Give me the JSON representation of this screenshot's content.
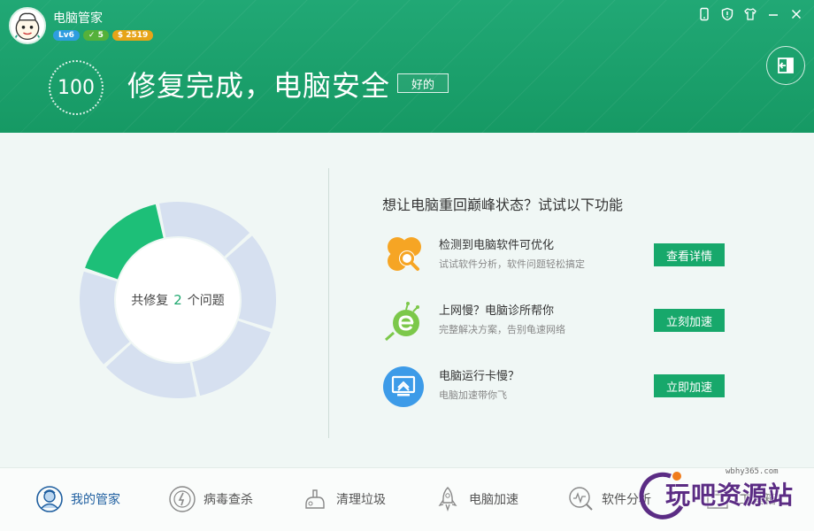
{
  "app": {
    "title": "电脑管家"
  },
  "badges": {
    "level": "Lv6",
    "ok": "5",
    "coins": "2519"
  },
  "window_controls": [
    "phone-icon",
    "shield-icon",
    "shirt-icon",
    "minimize-icon",
    "close-icon"
  ],
  "status": {
    "score": "100",
    "headline": "修复完成，电脑安全",
    "ok_label": "好的"
  },
  "summary": {
    "prefix": "共修复",
    "count": "2",
    "suffix": "个问题",
    "fixed_fraction": 0.167
  },
  "promo": {
    "title": "想让电脑重回巅峰状态？试试以下功能",
    "items": [
      {
        "title": "检测到电脑软件可优化",
        "desc": "试试软件分析，软件问题轻松搞定",
        "button": "查看详情",
        "icon": "clover-search-icon"
      },
      {
        "title": "上网慢？电脑诊所帮你",
        "desc": "完整解决方案，告别龟速网络",
        "button": "立刻加速",
        "icon": "browser-bug-icon"
      },
      {
        "title": "电脑运行卡慢？",
        "desc": "电脑加速带你飞",
        "button": "立即加速",
        "icon": "monitor-boost-icon"
      }
    ]
  },
  "nav": [
    {
      "label": "我的管家",
      "icon": "butler-icon",
      "active": true
    },
    {
      "label": "病毒查杀",
      "icon": "virus-scan-icon"
    },
    {
      "label": "清理垃圾",
      "icon": "cleanup-icon"
    },
    {
      "label": "电脑加速",
      "icon": "rocket-icon"
    },
    {
      "label": "软件分析",
      "icon": "software-analysis-icon"
    },
    {
      "label": "工具箱",
      "icon": "toolbox-icon"
    }
  ],
  "colors": {
    "brand_green": "#17a86b",
    "donut_fixed": "#1dbf78",
    "donut_rest": "#d6e0f0",
    "active_nav": "#1f5fa0"
  },
  "watermark": {
    "url": "wbhy365.com",
    "text": "玩吧资源站"
  }
}
